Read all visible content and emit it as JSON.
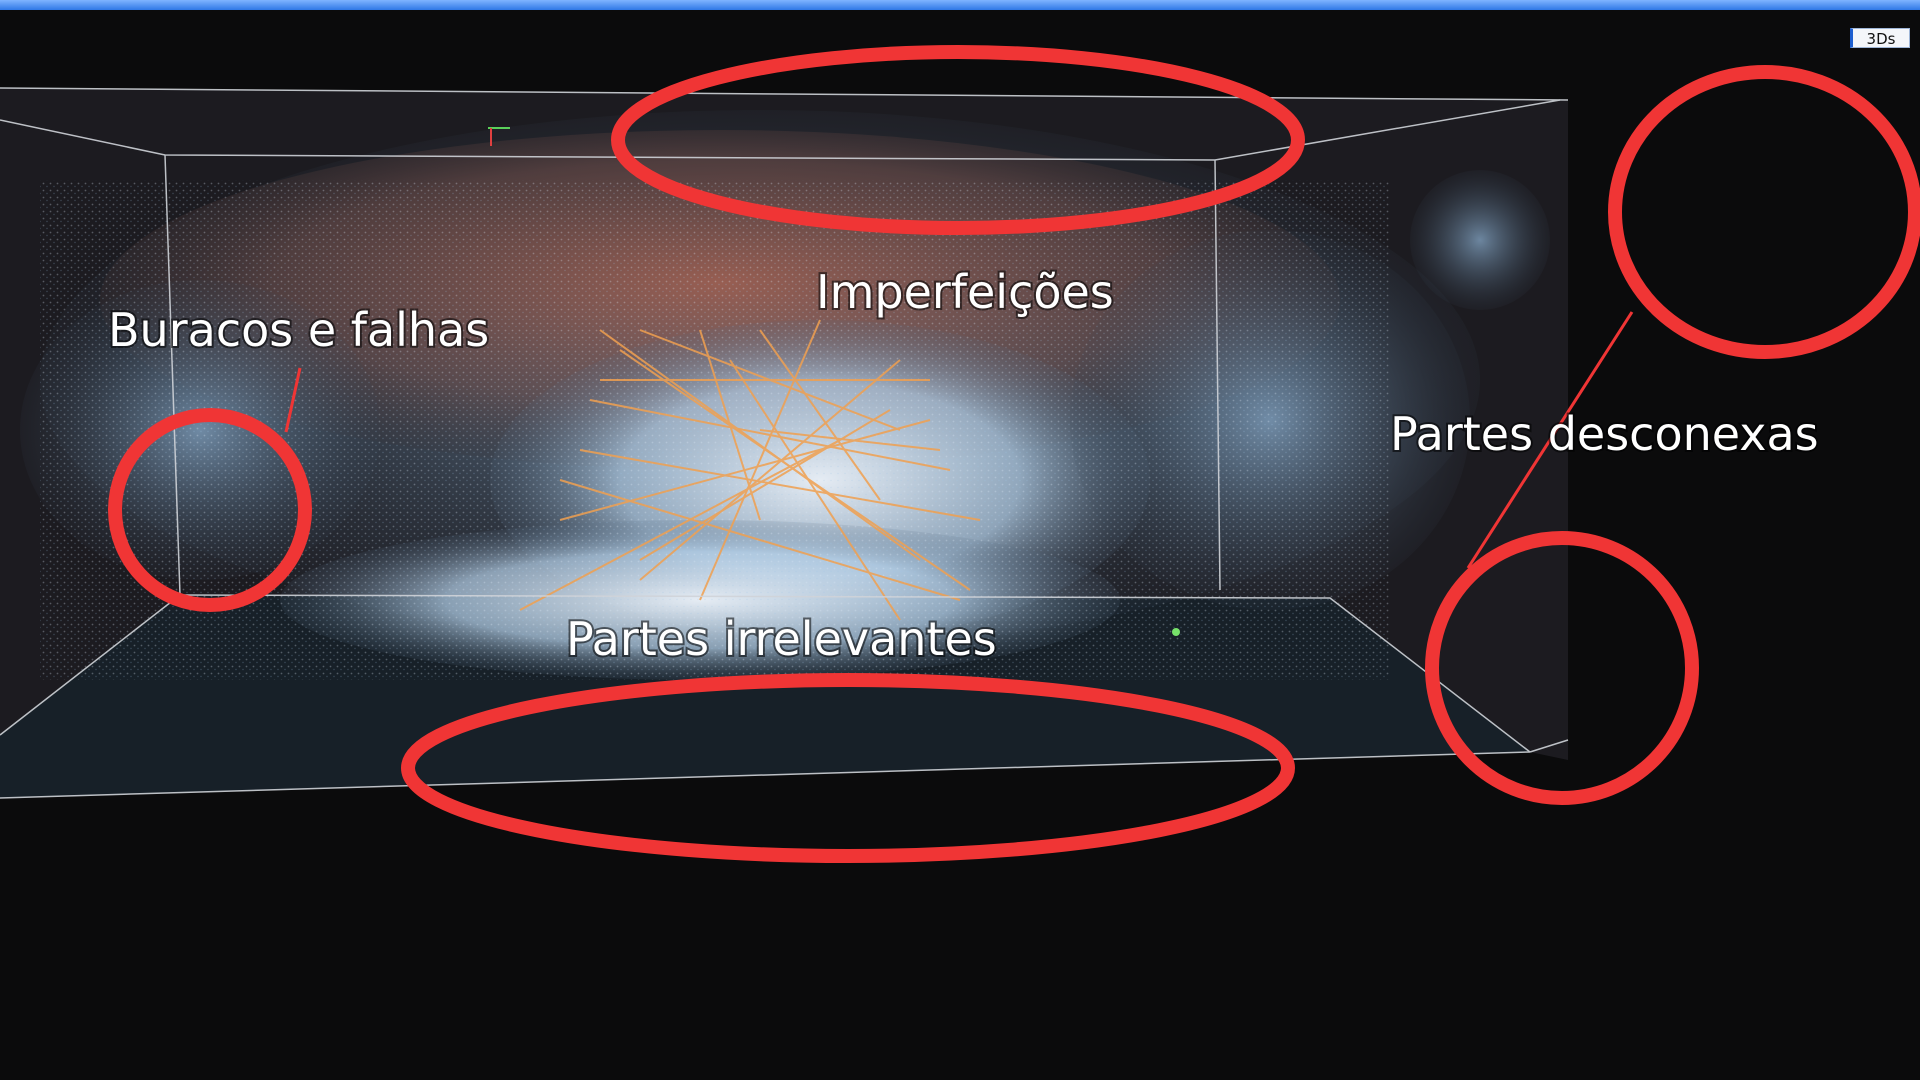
{
  "window": {
    "view_mode_badge": "3Ds"
  },
  "colors": {
    "top_bar": "#3d86f0",
    "background": "#0b0b0c",
    "scene_fill": "#1d1c21",
    "bounding_box": "#cfd3d8",
    "highlight_circle": "#f03535",
    "point_cloud_orange": "#c06a52",
    "point_cloud_blue": "#9fc7ea",
    "feature_lines": "#f0a050"
  },
  "annotations": [
    {
      "id": "imperfections",
      "label": "Imperfeições"
    },
    {
      "id": "holes",
      "label": "Buracos e falhas"
    },
    {
      "id": "disconnected",
      "label": "Partes desconexas"
    },
    {
      "id": "irrelevant",
      "label": "Partes irrelevantes"
    }
  ],
  "icons": [
    "axis-gizmo-icon"
  ]
}
